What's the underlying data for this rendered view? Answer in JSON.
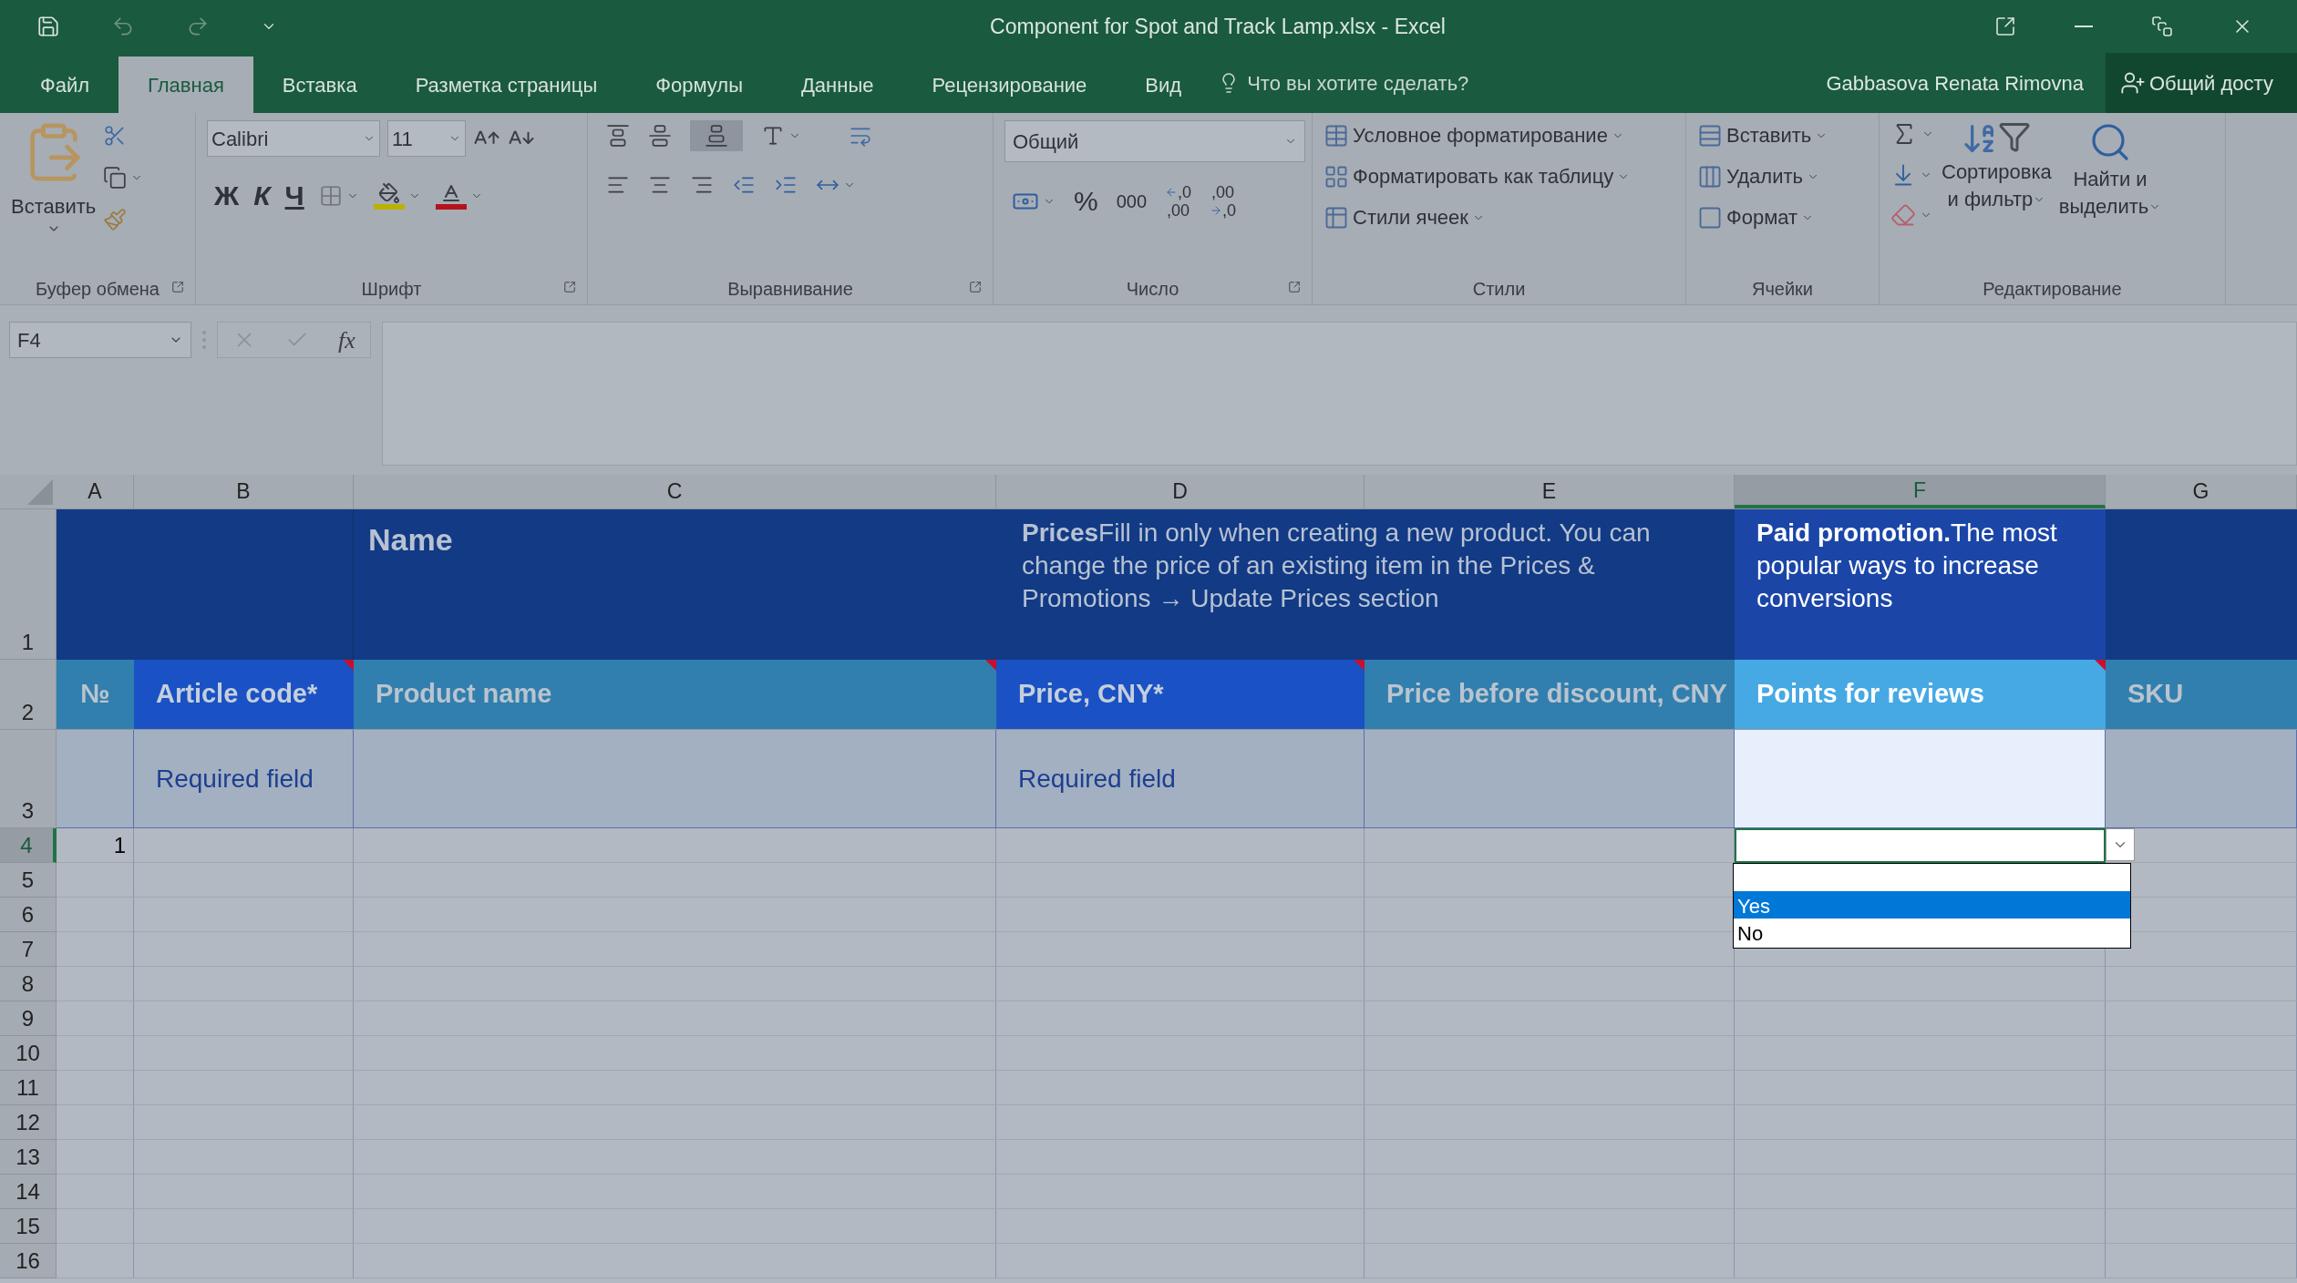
{
  "window": {
    "title": "Component for Spot and Track Lamp.xlsx - Excel"
  },
  "tabs": [
    {
      "label": "Файл",
      "selected": false
    },
    {
      "label": "Главная",
      "selected": true
    },
    {
      "label": "Вставка",
      "selected": false
    },
    {
      "label": "Разметка страницы",
      "selected": false
    },
    {
      "label": "Формулы",
      "selected": false
    },
    {
      "label": "Данные",
      "selected": false
    },
    {
      "label": "Рецензирование",
      "selected": false
    },
    {
      "label": "Вид",
      "selected": false
    }
  ],
  "tell_me": {
    "placeholder": "Что вы хотите сделать?"
  },
  "user": "Gabbasova Renata Rimovna",
  "share": "Общий досту",
  "ribbon": {
    "clipboard": {
      "paste": "Вставить",
      "label": "Буфер обмена"
    },
    "font": {
      "font_name": "Calibri",
      "font_size": "11",
      "bold": "Ж",
      "italic": "К",
      "underline": "Ч",
      "label": "Шрифт"
    },
    "alignment": {
      "label": "Выравнивание"
    },
    "number": {
      "format": "Общий",
      "percent": "%",
      "thousands": "000",
      "increase_decimal": [
        ",0",
        ",00"
      ],
      "decrease_decimal": [
        ",00",
        ",0"
      ],
      "label": "Число"
    },
    "styles": {
      "items": [
        "Условное форматирование",
        "Форматировать как таблицу",
        "Стили ячеек"
      ],
      "label": "Стили"
    },
    "cells": {
      "items": [
        "Вставить",
        "Удалить",
        "Формат"
      ],
      "label": "Ячейки"
    },
    "editing": {
      "sort": [
        "Сортировка",
        "и фильтр"
      ],
      "find": [
        "Найти и",
        "выделить"
      ],
      "label": "Редактирование"
    }
  },
  "formula_bar": {
    "name_box": "F4",
    "fx": "fx"
  },
  "sheet": {
    "columns": [
      {
        "label": "A",
        "selected": false
      },
      {
        "label": "B",
        "selected": false
      },
      {
        "label": "C",
        "selected": false
      },
      {
        "label": "D",
        "selected": false
      },
      {
        "label": "E",
        "selected": false
      },
      {
        "label": "F",
        "selected": true
      },
      {
        "label": "G",
        "selected": false
      }
    ],
    "rows": [
      {
        "label": "1",
        "selected": false
      },
      {
        "label": "2",
        "selected": false
      },
      {
        "label": "3",
        "selected": false
      },
      {
        "label": "4",
        "selected": true
      },
      {
        "label": "5",
        "selected": false
      },
      {
        "label": "6",
        "selected": false
      },
      {
        "label": "7",
        "selected": false
      },
      {
        "label": "8",
        "selected": false
      },
      {
        "label": "9",
        "selected": false
      },
      {
        "label": "10",
        "selected": false
      },
      {
        "label": "11",
        "selected": false
      },
      {
        "label": "12",
        "selected": false
      },
      {
        "label": "13",
        "selected": false
      },
      {
        "label": "14",
        "selected": false
      },
      {
        "label": "15",
        "selected": false
      },
      {
        "label": "16",
        "selected": false
      }
    ],
    "section_titles": [
      "Name",
      "**Prices**Fill in only when creating a new product. You can change the price of an existing item in the Prices & Promotions → Update Prices section",
      "**Paid promotion.**The most popular ways to increase conversions"
    ],
    "headers": [
      {
        "text": "№",
        "required": false,
        "comment": false
      },
      {
        "text": "Article code*",
        "required": true,
        "comment": true,
        "hint": "Required field"
      },
      {
        "text": "Product name",
        "required": false,
        "comment": true
      },
      {
        "text": "Price, CNY*",
        "required": true,
        "comment": true,
        "hint": "Required field"
      },
      {
        "text": "Price before discount, CNY",
        "required": false,
        "comment": false
      },
      {
        "text": "Points for reviews",
        "required": false,
        "comment": true
      },
      {
        "text": "SKU",
        "required": false,
        "comment": false
      }
    ],
    "first_row_number": "1",
    "dropdown": {
      "options": [
        {
          "label": "Yes",
          "selected": true
        },
        {
          "label": "No",
          "selected": false
        }
      ]
    }
  }
}
